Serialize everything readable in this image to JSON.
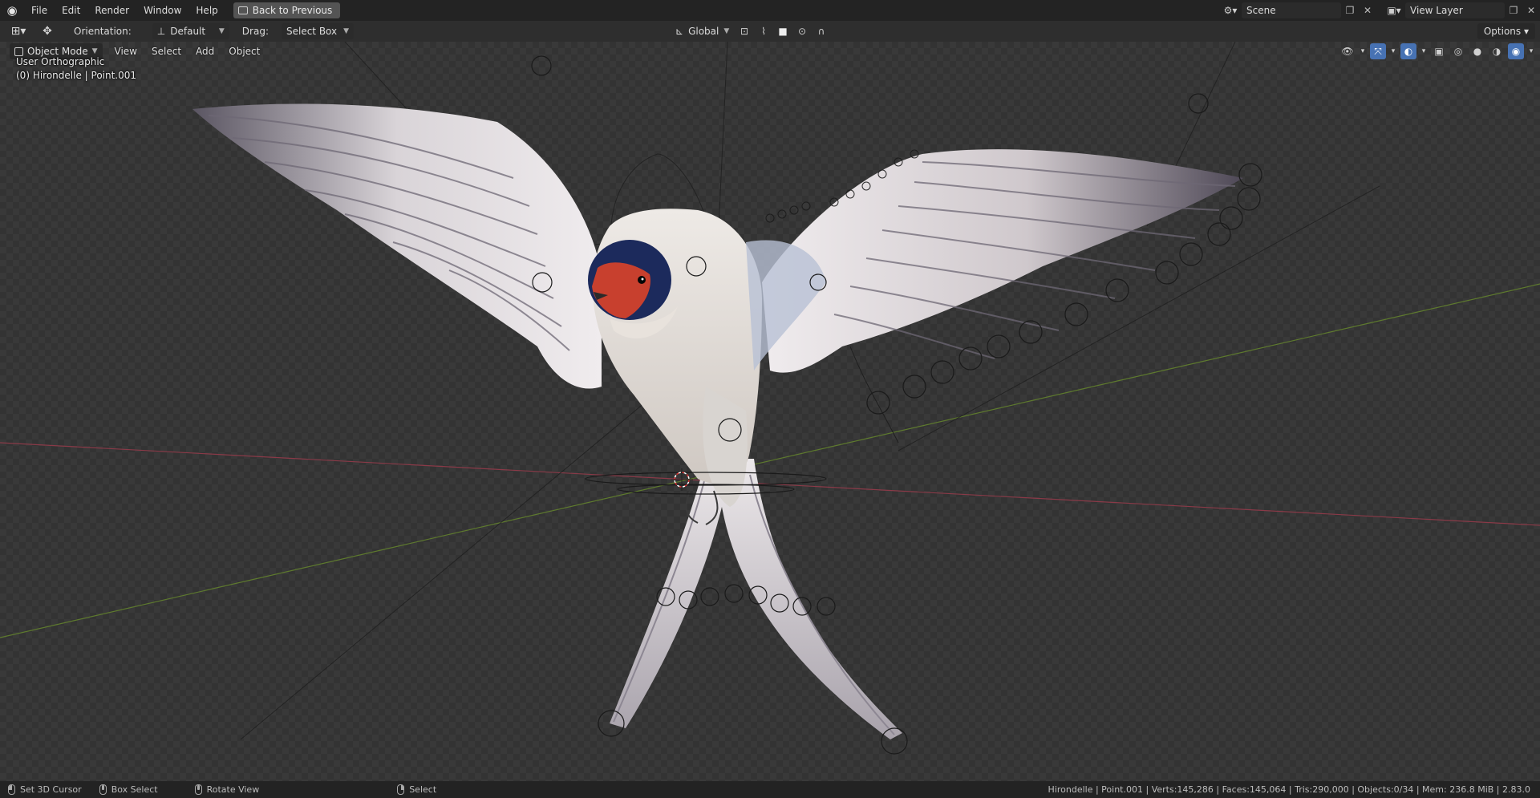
{
  "topbar": {
    "menu": [
      "File",
      "Edit",
      "Render",
      "Window",
      "Help"
    ],
    "back_label": "Back to Previous",
    "scene_label": "Scene",
    "view_layer_label": "View Layer"
  },
  "toolbar": {
    "orientation_label": "Orientation:",
    "orientation_value": "Default",
    "drag_label": "Drag:",
    "drag_value": "Select Box",
    "transform_space": "Global",
    "options_label": "Options"
  },
  "viewport": {
    "mode": "Object Mode",
    "menu": [
      "View",
      "Select",
      "Add",
      "Object"
    ],
    "view_name": "User Orthographic",
    "object_info": "(0) Hirondelle | Point.001"
  },
  "statusbar": {
    "set_cursor": "Set 3D Cursor",
    "box_select": "Box Select",
    "rotate_view": "Rotate View",
    "select": "Select",
    "stats": "Hirondelle | Point.001 | Verts:145,286 | Faces:145,064 | Tris:290,000 | Objects:0/34 | Mem: 236.8 MiB | 2.83.0"
  },
  "colors": {
    "accent": "#4772b3",
    "x_axis": "#8a3a48",
    "y_axis": "#5e7a2e",
    "bird_red": "#c8402e",
    "bird_cap": "#1c2a5c"
  }
}
